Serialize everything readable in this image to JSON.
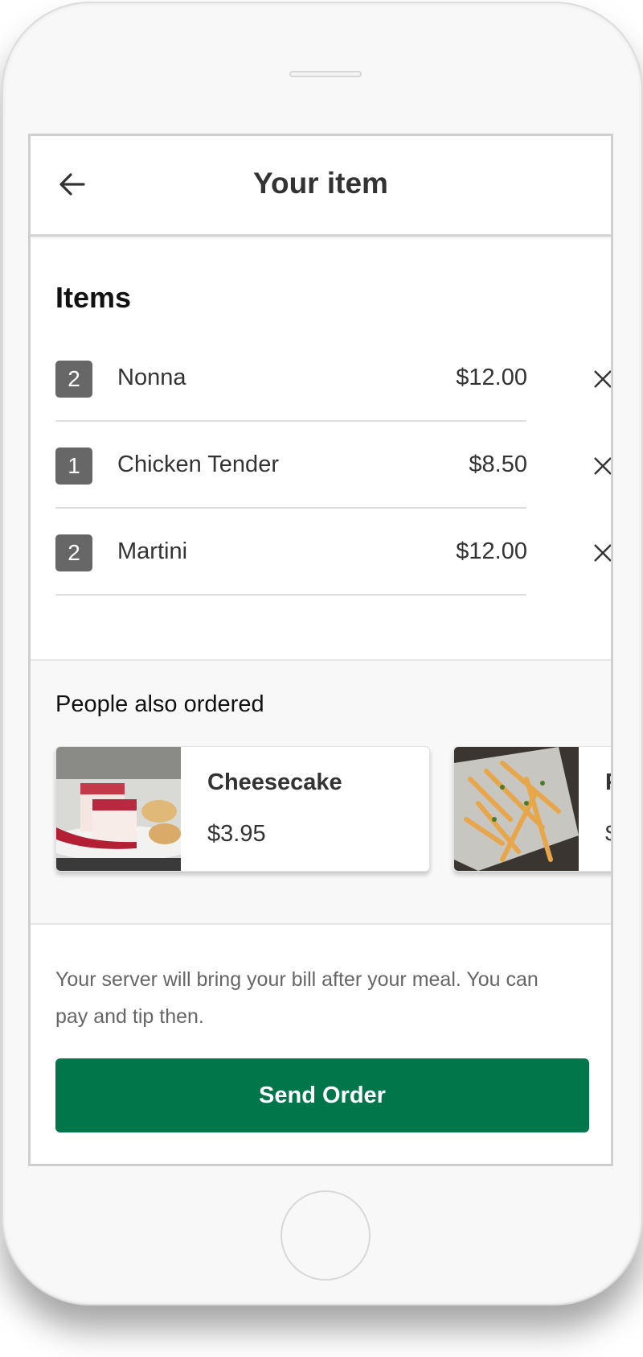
{
  "header": {
    "title": "Your item",
    "back_icon": "arrow-left-icon"
  },
  "items": {
    "heading": "Items",
    "rows": [
      {
        "qty": "2",
        "name": "Nonna",
        "price": "$12.00"
      },
      {
        "qty": "1",
        "name": "Chicken Tender",
        "price": "$8.50"
      },
      {
        "qty": "2",
        "name": "Martini",
        "price": "$12.00"
      }
    ]
  },
  "also_ordered": {
    "heading": "People also ordered",
    "cards": [
      {
        "name": "Cheesecake",
        "price": "$3.95"
      },
      {
        "name": "F",
        "price": "$"
      }
    ]
  },
  "note": "Your server will bring your bill after your meal. You can pay and tip then.",
  "send_button": "Send Order",
  "colors": {
    "accent": "#00764a",
    "badge": "#676767"
  }
}
